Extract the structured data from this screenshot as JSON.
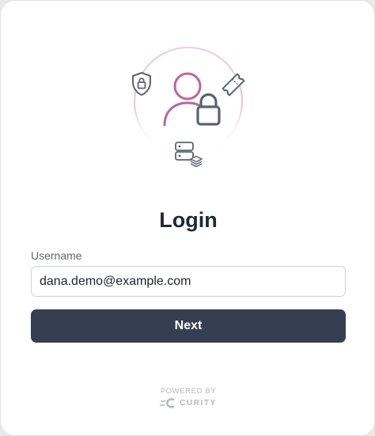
{
  "login": {
    "title": "Login",
    "username_label": "Username",
    "username_value": "dana.demo@example.com",
    "next_label": "Next"
  },
  "footer": {
    "powered_by": "POWERED BY",
    "brand": "CURITY"
  },
  "icons": {
    "illustration": [
      "shield-lock-icon",
      "user-icon",
      "padlock-icon",
      "ticket-icon",
      "server-stack-icon"
    ],
    "brand_logo": "curity-logo-icon"
  },
  "colors": {
    "accent": "#c0639a",
    "button": "#363e52",
    "icon_gray": "#5b6274",
    "text": "#1f2937"
  }
}
